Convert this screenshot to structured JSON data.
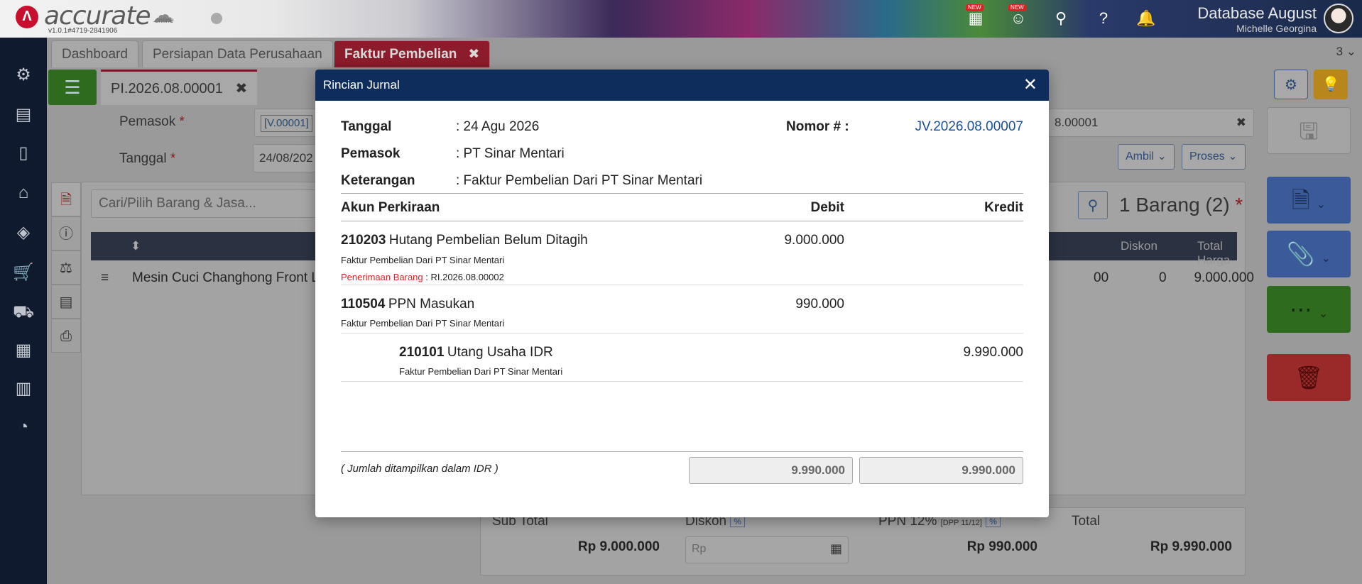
{
  "header": {
    "logo_text": "accurate",
    "logo_sub": "online",
    "version": "v1.0.1#4719-2841906",
    "db_title": "Database August",
    "db_user": "Michelle Georgina",
    "badge_new": "NEW"
  },
  "tabs": [
    {
      "label": "Dashboard"
    },
    {
      "label": "Persiapan Data Perusahaan"
    },
    {
      "label": "Faktur Pembelian"
    }
  ],
  "page_count": "3",
  "subtab": {
    "label": "PI.2026.08.00001"
  },
  "form": {
    "pemasok_label": "Pemasok",
    "pemasok_code": "[V.00001]",
    "tanggal_label": "Tanggal",
    "tanggal_value": "24/08/202",
    "no_partial": "8.00001",
    "ambil_label": "Ambil",
    "proses_label": "Proses"
  },
  "items": {
    "search_placeholder": "Cari/Pilih Barang & Jasa...",
    "count_label": "1 Barang (2)",
    "columns": {
      "diskon": "Diskon",
      "total_harga": "Total Harga"
    },
    "row": {
      "name": "Mesin Cuci Changhong Front L",
      "partial": "00",
      "diskon": "0",
      "total": "9.000.000"
    }
  },
  "summary": {
    "subtotal_label": "Sub Total",
    "subtotal_value": "Rp 9.000.000",
    "diskon_label": "Diskon",
    "diskon_placeholder": "Rp",
    "ppn_label": "PPN 12%",
    "ppn_dpp": "[DPP 11/12]",
    "ppn_value": "Rp 990.000",
    "total_label": "Total",
    "total_value": "Rp 9.990.000",
    "pct": "%"
  },
  "modal": {
    "title": "Rincian Jurnal",
    "tanggal_label": "Tanggal",
    "tanggal_value": ": 24 Agu 2026",
    "pemasok_label": "Pemasok",
    "pemasok_value": ": PT Sinar Mentari",
    "keterangan_label": "Keterangan",
    "keterangan_value": ": Faktur Pembelian Dari PT Sinar Mentari",
    "nomor_label": "Nomor # :",
    "nomor_value": "JV.2026.08.00007",
    "columns": {
      "akun": "Akun Perkiraan",
      "debit": "Debit",
      "kredit": "Kredit"
    },
    "rows": [
      {
        "code": "210203",
        "name": "Hutang Pembelian Belum Ditagih",
        "desc": "Faktur Pembelian Dari PT Sinar Mentari",
        "ref_label": "Penerimaan Barang",
        "ref_value": " : RI.2026.08.00002",
        "debit": "9.000.000",
        "kredit": ""
      },
      {
        "code": "110504",
        "name": "PPN Masukan",
        "desc": "Faktur Pembelian Dari PT Sinar Mentari",
        "debit": "990.000",
        "kredit": ""
      },
      {
        "code": "210101",
        "name": "Utang Usaha IDR",
        "desc": "Faktur Pembelian Dari PT Sinar Mentari",
        "debit": "",
        "kredit": "9.990.000"
      }
    ],
    "currency_note": "( Jumlah ditampilkan dalam IDR )",
    "total_debit": "9.990.000",
    "total_kredit": "9.990.000"
  }
}
